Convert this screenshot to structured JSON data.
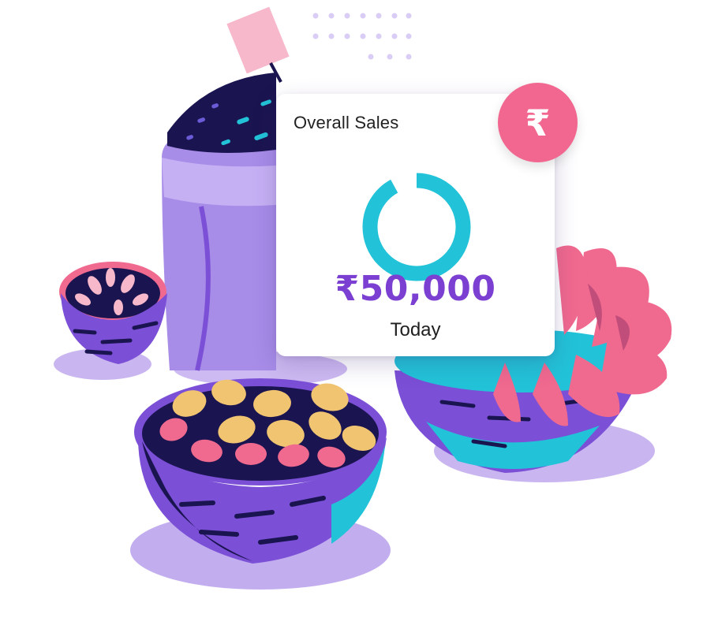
{
  "sales_card": {
    "title": "Overall Sales",
    "amount": "₹50,000",
    "period": "Today",
    "progress_fraction": 0.92,
    "ring_color": "#22c3d8",
    "amount_color": "#7b3fd1"
  },
  "currency_badge": {
    "glyph": "₹",
    "icon": "rupee-icon",
    "color": "#f2678f"
  },
  "illustration": {
    "colors": {
      "purple": "#7b4fd6",
      "lavender": "#a78ce8",
      "navy": "#1a1450",
      "pink": "#f0698f",
      "cyan": "#22c3d8",
      "nut": "#f1c471"
    }
  }
}
